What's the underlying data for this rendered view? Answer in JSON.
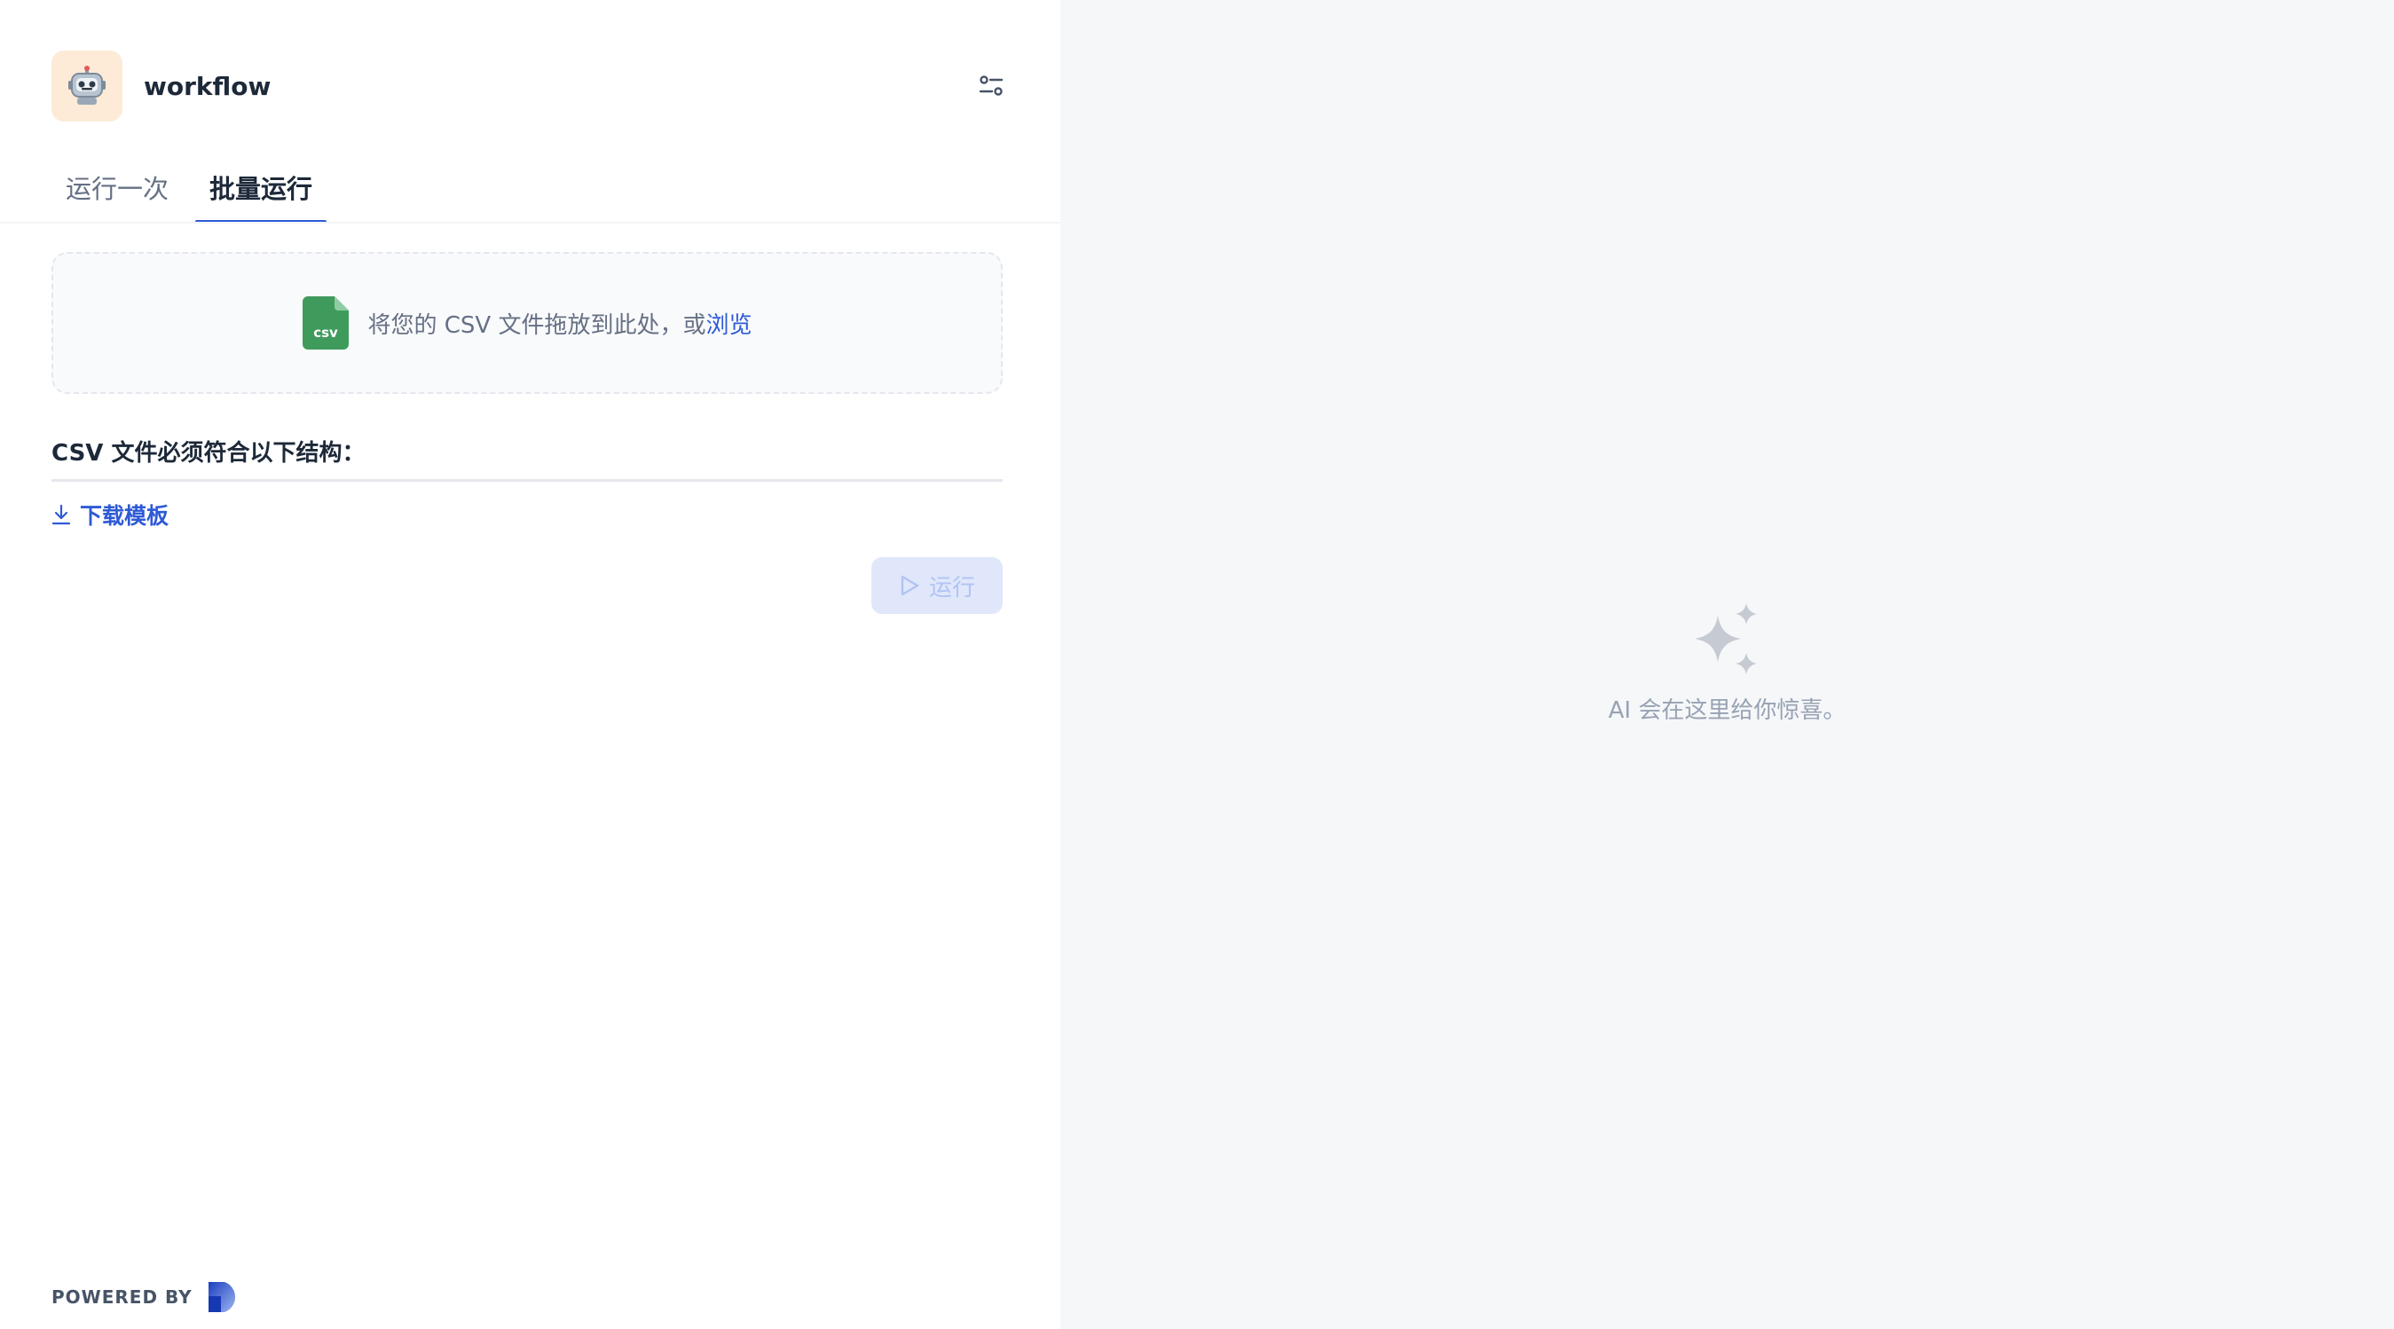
{
  "app": {
    "name": "workflow",
    "icon": "robot-icon"
  },
  "tabs": [
    {
      "label": "运行一次",
      "active": false
    },
    {
      "label": "批量运行",
      "active": true
    }
  ],
  "upload": {
    "text": "将您的 CSV 文件拖放到此处，或",
    "link": "浏览",
    "file_icon_label": "csv"
  },
  "structure": {
    "title": "CSV 文件必须符合以下结构："
  },
  "download": {
    "label": "下载模板"
  },
  "run": {
    "label": "运行",
    "disabled": true
  },
  "result": {
    "empty_text": "AI 会在这里给你惊喜。"
  },
  "footer": {
    "powered_by": "POWERED BY"
  },
  "colors": {
    "accent": "#2e5ad6",
    "right_bg": "#f6f7f9",
    "csv_green": "#3f9b5c"
  }
}
